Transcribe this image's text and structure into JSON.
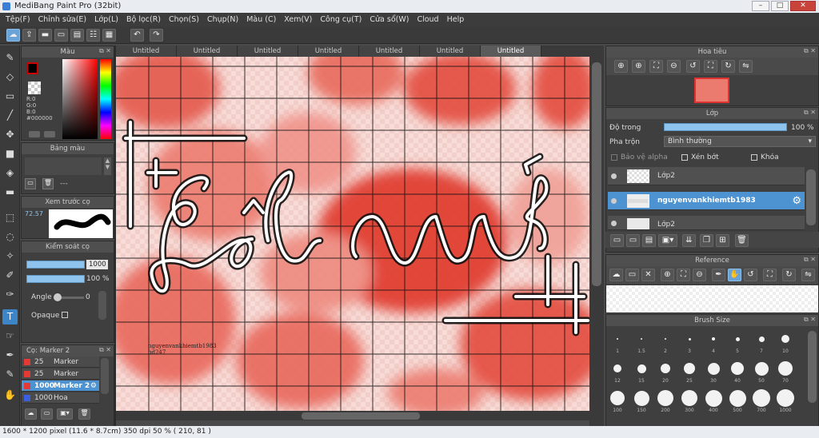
{
  "window": {
    "title": "MediBang Paint Pro (32bit)"
  },
  "menu": [
    "Tệp(F)",
    "Chỉnh sửa(E)",
    "Lớp(L)",
    "Bộ lọc(R)",
    "Chọn(S)",
    "Chụp(N)",
    "Màu (C)",
    "Xem(V)",
    "Công cụ(T)",
    "Cửa sổ(W)",
    "Cloud",
    "Help"
  ],
  "tabs": [
    "Untitled",
    "Untitled",
    "Untitled",
    "Untitled",
    "Untitled",
    "Untitled",
    "Untitled"
  ],
  "color_panel": {
    "title": "Màu",
    "r": "R:0",
    "g": "G:0",
    "b": "B:0",
    "hex": "#000000"
  },
  "palette_panel": {
    "title": "Bảng màu",
    "dash": "---"
  },
  "preview_panel": {
    "title": "Xem trước cọ",
    "value": "72.57"
  },
  "brush_control": {
    "title": "Kiểm soát cọ",
    "size": "1000",
    "opacity": "100 %",
    "angle_label": "Angle",
    "angle_value": "0",
    "opaque_label": "Opaque"
  },
  "brush_list": {
    "title": "Cọ: Marker 2",
    "items": [
      {
        "size": "25",
        "name": "Marker",
        "color": "#e53935"
      },
      {
        "size": "25",
        "name": "Marker",
        "color": "#e53935"
      },
      {
        "size": "1000",
        "name": "Marker 2",
        "color": "#e53935"
      },
      {
        "size": "1000",
        "name": "Hoa",
        "color": "#3b5fe0"
      }
    ]
  },
  "canvas": {
    "watermark_line1": "nguyenvankhiemtb1983",
    "watermark_line2": "bd247"
  },
  "navigator": {
    "title": "Hoa tiêu"
  },
  "layer_panel": {
    "title": "Lớp",
    "opacity_label": "Độ trong",
    "opacity_value": "100 %",
    "opacity": 1.0,
    "blend_label": "Pha trộn",
    "blend_value": "Bình thường",
    "protect_alpha": "Bảo vệ alpha",
    "clipping": "Xén bớt",
    "lock": "Khóa",
    "layers": [
      "Lớp2",
      "nguyenvankhiemtb1983",
      "Lớp2"
    ]
  },
  "reference": {
    "title": "Reference"
  },
  "brush_size": {
    "title": "Brush Size",
    "sizes": [
      "1",
      "1.5",
      "2",
      "3",
      "4",
      "5",
      "7",
      "10",
      "12",
      "15",
      "20",
      "25",
      "30",
      "40",
      "50",
      "70",
      "100",
      "150",
      "200",
      "300",
      "400",
      "500",
      "700",
      "1000"
    ]
  },
  "status": {
    "text": "1600 * 1200 pixel   (11.6 * 8.7cm)  350 dpi  50 %   ( 210, 81 )"
  }
}
